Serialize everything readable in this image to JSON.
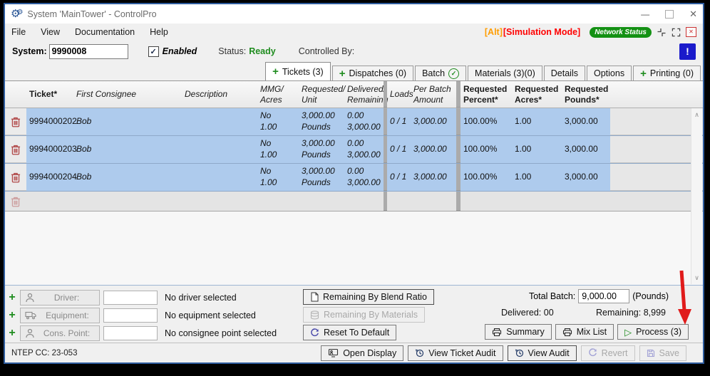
{
  "icons": {
    "gear": "⚙",
    "minimize": "—",
    "close": "✕",
    "plus": "+",
    "check": "✓",
    "play": "▷",
    "chevron_up": "∧",
    "chevron_down": "∨",
    "alert": "!",
    "boxed_x": "✕"
  },
  "titlebar": {
    "title": "System 'MainTower' - ControlPro"
  },
  "menubar": {
    "items": [
      "File",
      "View",
      "Documentation",
      "Help"
    ],
    "alt_badge": "[Alt]",
    "simulation_badge": "[Simulation Mode]",
    "network_status": "Network Status"
  },
  "system_bar": {
    "system_label": "System:",
    "system_value": "9990008",
    "enabled_label": "Enabled",
    "status_label": "Status:",
    "status_value": "Ready",
    "controlled_by_label": "Controlled By:"
  },
  "tabs": [
    {
      "label": "Tickets (3)"
    },
    {
      "label": "Dispatches (0)"
    },
    {
      "label": "Batch"
    },
    {
      "label": "Materials (3)(0)"
    },
    {
      "label": "Details"
    },
    {
      "label": "Options"
    },
    {
      "label": "Printing (0)"
    }
  ],
  "table": {
    "columns": {
      "ticket": "Ticket*",
      "first_consignee": "First Consignee",
      "description": "Description",
      "mmg_acres": "MMG/\nAcres",
      "requested_unit": "Requested/\nUnit",
      "delivered_remaining": "Delivered/\nRemaining",
      "loads": "Loads",
      "per_batch_amount": "Per Batch\nAmount",
      "requested_percent": "Requested\nPercent*",
      "requested_acres": "Requested\nAcres*",
      "requested_pounds": "Requested\nPounds*"
    },
    "rows": [
      {
        "ticket": "9994000202",
        "first_consignee": "Bob",
        "description": "",
        "mmg_acres": "No\n1.00",
        "requested_unit": "3,000.00\nPounds",
        "delivered_remaining": "0.00\n3,000.00",
        "loads": "0 / 1",
        "per_batch_amount": "3,000.00",
        "requested_percent": "100.00%",
        "requested_acres": "1.00",
        "requested_pounds": "3,000.00"
      },
      {
        "ticket": "9994000203",
        "first_consignee": "Bob",
        "description": "",
        "mmg_acres": "No\n1.00",
        "requested_unit": "3,000.00\nPounds",
        "delivered_remaining": "0.00\n3,000.00",
        "loads": "0 / 1",
        "per_batch_amount": "3,000.00",
        "requested_percent": "100.00%",
        "requested_acres": "1.00",
        "requested_pounds": "3,000.00"
      },
      {
        "ticket": "9994000204",
        "first_consignee": "Bob",
        "description": "",
        "mmg_acres": "No\n1.00",
        "requested_unit": "3,000.00\nPounds",
        "delivered_remaining": "0.00\n3,000.00",
        "loads": "0 / 1",
        "per_batch_amount": "3,000.00",
        "requested_percent": "100.00%",
        "requested_acres": "1.00",
        "requested_pounds": "3,000.00"
      }
    ]
  },
  "footer": {
    "assignments": [
      {
        "label": "Driver:",
        "status": "No driver selected"
      },
      {
        "label": "Equipment:",
        "status": "No equipment selected"
      },
      {
        "label": "Cons. Point:",
        "status": "No consignee point selected"
      }
    ],
    "blend_button": "Remaining By Blend Ratio",
    "materials_button": "Remaining By Materials",
    "reset_button": "Reset To Default",
    "total_batch_label": "Total Batch:",
    "total_batch_value": "9,000.00",
    "total_batch_unit": "(Pounds)",
    "delivered_label": "Delivered:",
    "delivered_value": "00",
    "remaining_label": "Remaining:",
    "remaining_value": "8,999",
    "summary_button": "Summary",
    "mixlist_button": "Mix List",
    "process_button": "Process (3)"
  },
  "statusbar": {
    "ntep": "NTEP CC: 23-053",
    "open_display": "Open Display",
    "view_ticket_audit": "View Ticket Audit",
    "view_audit": "View Audit",
    "revert": "Revert",
    "save": "Save"
  },
  "colors": {
    "window_border": "#2e5c9e",
    "selection_blue": "#aecbed",
    "status_green": "#1e8c1e",
    "network_green": "#149114",
    "alt_orange": "#ff9d00",
    "simulation_red": "#ff0000",
    "trash_red": "#b04747",
    "arrow_red": "#e01b1b",
    "alert_blue": "#1a1acb"
  }
}
